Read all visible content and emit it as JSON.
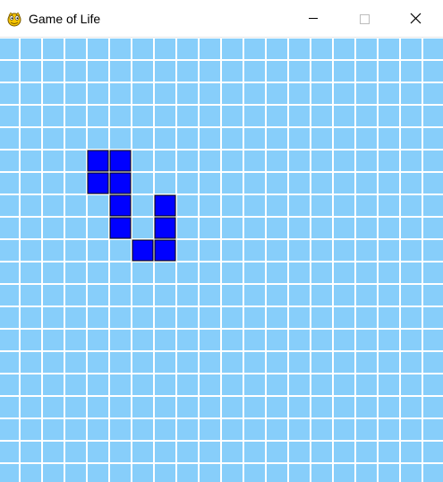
{
  "window": {
    "title": "Game of Life",
    "icon": "pygame-snake-icon",
    "controls": [
      "minimize-icon",
      "maximize-icon",
      "close-icon"
    ]
  },
  "colors": {
    "background": "#87cefa",
    "grid_line": "#ffffff",
    "alive_cell": "#0000ff",
    "cell_border": "#000000"
  },
  "grid": {
    "columns": 20,
    "rows": 20,
    "alive_cells": [
      {
        "col": 4,
        "row": 5
      },
      {
        "col": 5,
        "row": 5
      },
      {
        "col": 4,
        "row": 6
      },
      {
        "col": 5,
        "row": 6
      },
      {
        "col": 5,
        "row": 7
      },
      {
        "col": 7,
        "row": 7
      },
      {
        "col": 5,
        "row": 8
      },
      {
        "col": 7,
        "row": 8
      },
      {
        "col": 6,
        "row": 9
      },
      {
        "col": 7,
        "row": 9
      }
    ]
  }
}
